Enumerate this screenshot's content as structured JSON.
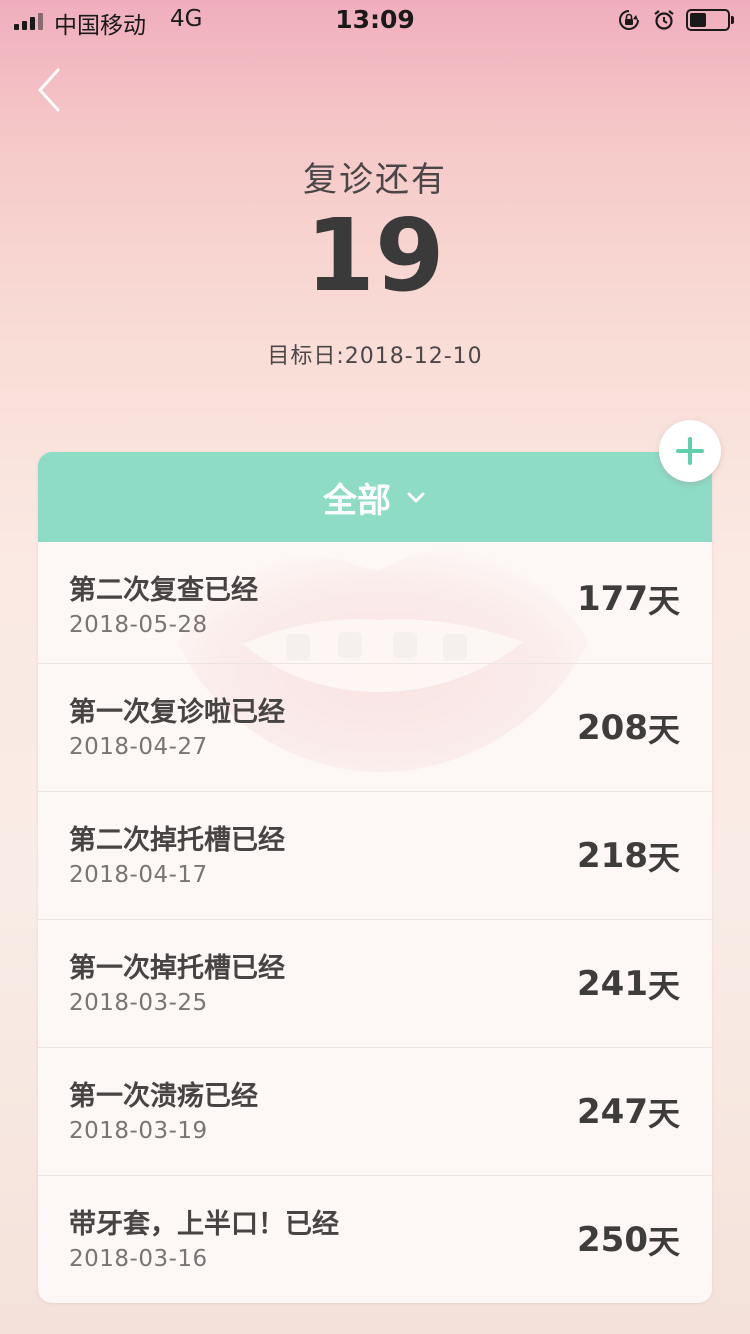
{
  "status_bar": {
    "carrier": "中国移动",
    "network": "4G",
    "time": "13:09",
    "battery_level": 0.45
  },
  "header": {
    "title": "复诊还有",
    "countdown": "19",
    "target_date": "目标日:2018-12-10"
  },
  "filter": {
    "label": "全部"
  },
  "records": [
    {
      "title": "第二次复查已经",
      "date": "2018-05-28",
      "days": "177",
      "unit": "天"
    },
    {
      "title": "第一次复诊啦已经",
      "date": "2018-04-27",
      "days": "208",
      "unit": "天"
    },
    {
      "title": "第二次掉托槽已经",
      "date": "2018-04-17",
      "days": "218",
      "unit": "天"
    },
    {
      "title": "第一次掉托槽已经",
      "date": "2018-03-25",
      "days": "241",
      "unit": "天"
    },
    {
      "title": "第一次溃疡已经",
      "date": "2018-03-19",
      "days": "247",
      "unit": "天"
    },
    {
      "title": "带牙套，上半口！已经",
      "date": "2018-03-16",
      "days": "250",
      "unit": "天"
    }
  ],
  "colors": {
    "accent": "#8edbc6",
    "add_icon": "#5fcfae"
  }
}
